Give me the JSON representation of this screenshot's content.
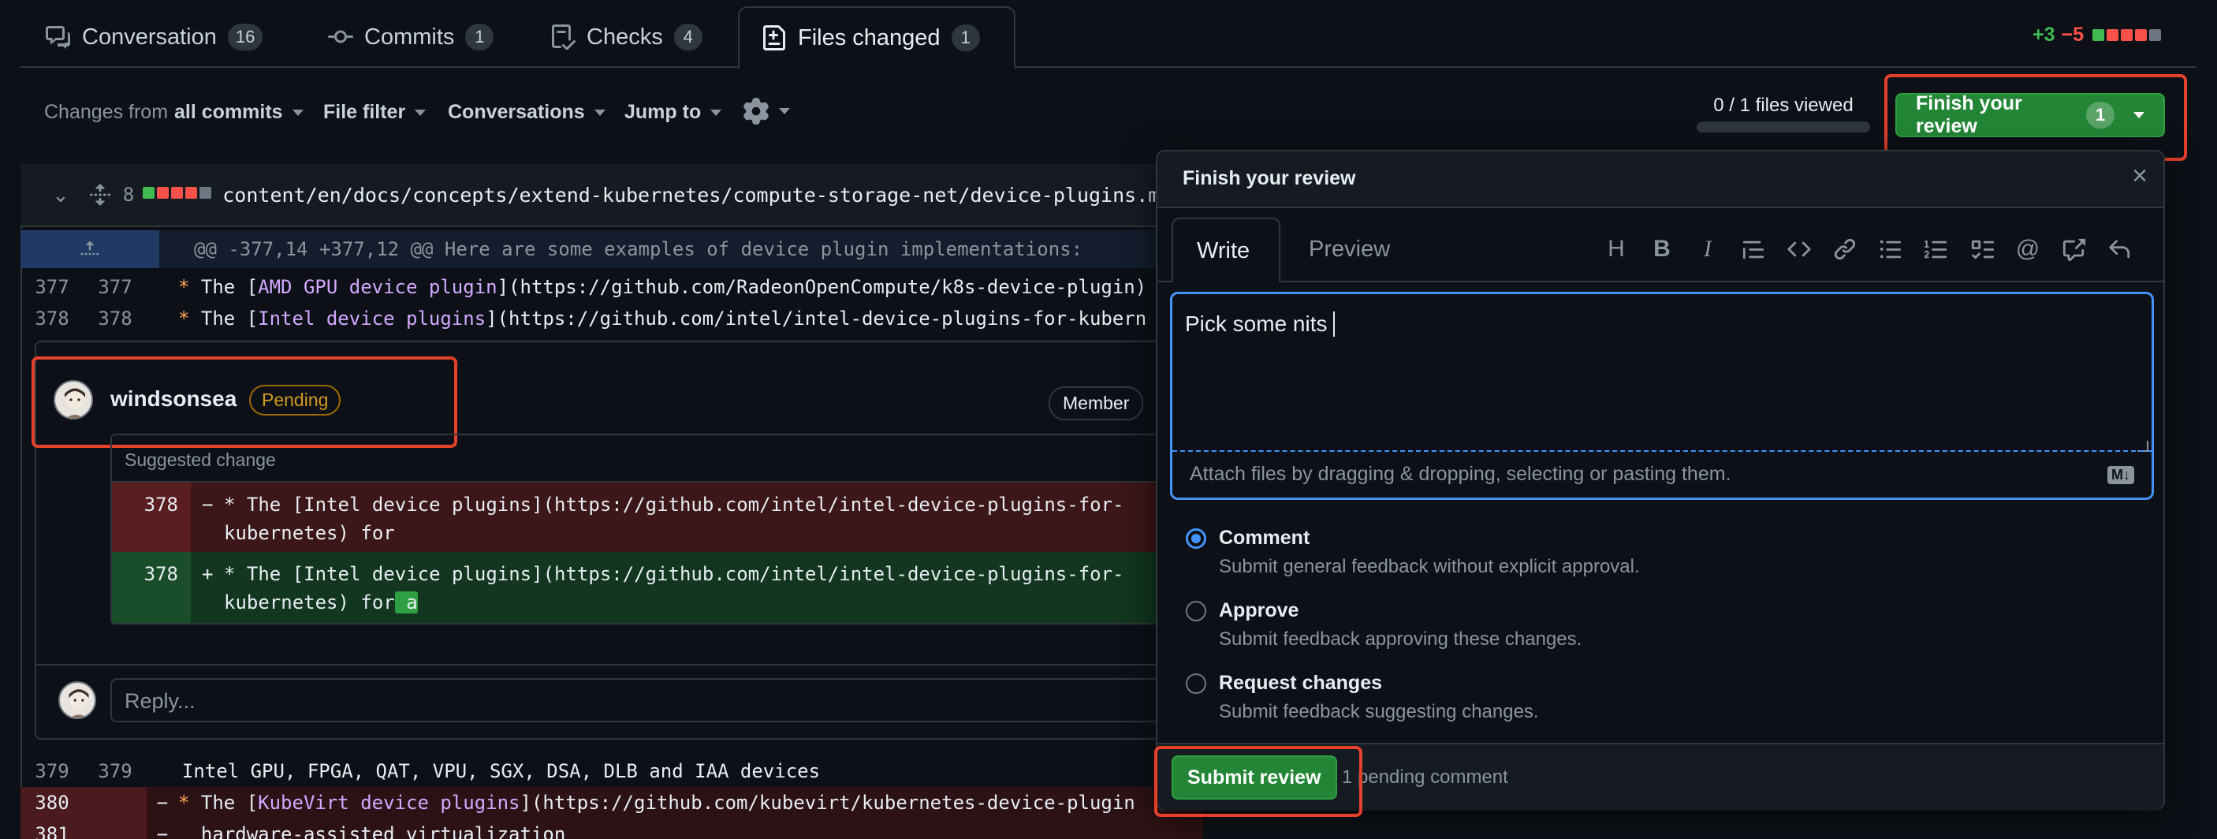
{
  "tabs": [
    {
      "label": "Conversation",
      "count": "16",
      "icon": "comment-discussion-icon"
    },
    {
      "label": "Commits",
      "count": "1",
      "icon": "git-commit-icon"
    },
    {
      "label": "Checks",
      "count": "4",
      "icon": "checklist-icon"
    },
    {
      "label": "Files changed",
      "count": "1",
      "icon": "file-diff-icon"
    }
  ],
  "diffstat": {
    "additions": "+3",
    "deletions": "−5"
  },
  "toolbar": {
    "changes_prefix": "Changes from",
    "changes_value": "all commits",
    "file_filter": "File filter",
    "conversations": "Conversations",
    "jump_to": "Jump to",
    "files_viewed": "0 / 1 files viewed",
    "finish_review": "Finish your review",
    "finish_review_count": "1"
  },
  "file": {
    "changed_lines": "8",
    "path": "content/en/docs/concepts/extend-kubernetes/compute-storage-net/device-plugins.md",
    "hunk": "@@ -377,14 +377,12 @@ Here are some examples of device plugin implementations:",
    "lines": [
      {
        "old": "377",
        "new": "377",
        "sign": "",
        "star": "*",
        "pre": " The [",
        "link": "AMD GPU device plugin",
        "post": "](https://github.com/RadeonOpenCompute/k8s-device-plugin)"
      },
      {
        "old": "378",
        "new": "378",
        "sign": "",
        "star": "*",
        "pre": " The [",
        "link": "Intel device plugins",
        "post": "](https://github.com/intel/intel-device-plugins-for-kubern"
      }
    ],
    "lines_after": [
      {
        "old": "379",
        "new": "379",
        "text": "  Intel GPU, FPGA, QAT, VPU, SGX, DSA, DLB and IAA devices"
      },
      {
        "old": "380",
        "new": "",
        "sign": "−",
        "star": "*",
        "pre": " The [",
        "link": "KubeVirt device plugins",
        "post": "](https://github.com/kubevirt/kubernetes-device-plugin"
      },
      {
        "old": "381",
        "new": "",
        "sign": "−",
        "text": "  hardware-assisted virtualization"
      }
    ]
  },
  "comment": {
    "author": "windsonsea",
    "status": "Pending",
    "role": "Member",
    "suggested_label": "Suggested change",
    "del_line_no": "378",
    "del_sign": "−",
    "del_text_1": "* The [Intel device plugins](https://github.com/intel/intel-device-plugins-for-",
    "del_text_2": "kubernetes) for",
    "add_line_no": "378",
    "add_sign": "+",
    "add_text_1": "* The [Intel device plugins](https://github.com/intel/intel-device-plugins-for-",
    "add_text_2": "kubernetes) for",
    "add_highlight": " a",
    "reply_placeholder": "Reply..."
  },
  "review": {
    "title": "Finish your review",
    "tab_write": "Write",
    "tab_preview": "Preview",
    "body": "Pick some nits ",
    "attach_hint": "Attach files by dragging & dropping, selecting or pasting them.",
    "markdown_badge": "M↓",
    "options": [
      {
        "title": "Comment",
        "desc": "Submit general feedback without explicit approval.",
        "selected": true
      },
      {
        "title": "Approve",
        "desc": "Submit feedback approving these changes.",
        "selected": false
      },
      {
        "title": "Request changes",
        "desc": "Submit feedback suggesting changes.",
        "selected": false
      }
    ],
    "submit": "Submit review",
    "pending_note": "1 pending comment"
  },
  "colors": {
    "accent_blue": "#4493f8",
    "green": "#238636",
    "annotation_red": "#e5402a",
    "pending_amber": "#d29922"
  }
}
